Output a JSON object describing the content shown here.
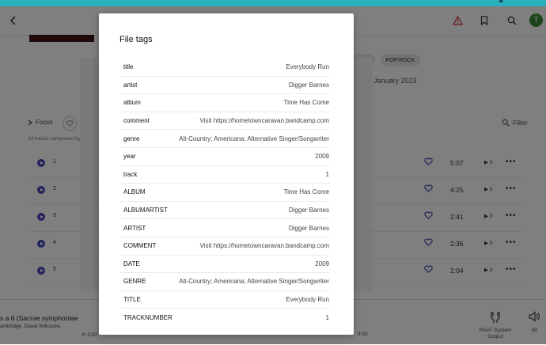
{
  "header": {
    "icons": [
      "chevron-left-icon",
      "warning-icon",
      "bookmark-icon",
      "search-icon"
    ],
    "avatar_letter": "T"
  },
  "album": {
    "genre_chip": "POP/ROCK",
    "date": "January 2023",
    "focus_label": "Focus",
    "composed_note": "All tracks composed by",
    "filter_label": "Filter"
  },
  "tracks": [
    {
      "num": "1",
      "duration": "5:07",
      "plays": "3"
    },
    {
      "num": "2",
      "duration": "4:25",
      "plays": "3"
    },
    {
      "num": "3",
      "duration": "2:41",
      "plays": "3"
    },
    {
      "num": "4",
      "duration": "2:36",
      "plays": "3"
    },
    {
      "num": "5",
      "duration": "2:04",
      "plays": "3"
    }
  ],
  "player": {
    "title": "s a 6 (Sacrae symphoniae",
    "artist": "ambridge, David Willcocks",
    "elapsed": "2:02",
    "total": "3:33",
    "zone_line1": "RAAT System",
    "zone_line2": "Output",
    "volume": "80"
  },
  "modal": {
    "title": "File tags",
    "tags": [
      {
        "key": "title",
        "value": "Everybody Run"
      },
      {
        "key": "artist",
        "value": "Digger Barnes"
      },
      {
        "key": "album",
        "value": "Time Has Come"
      },
      {
        "key": "comment",
        "value": "Visit https://hometowncaravan.bandcamp.com"
      },
      {
        "key": "genre",
        "value": "Alt-Country; Americana; Alternative Singer/Songwriter"
      },
      {
        "key": "year",
        "value": "2009"
      },
      {
        "key": "track",
        "value": "1"
      },
      {
        "key": "ALBUM",
        "value": "Time Has Come"
      },
      {
        "key": "ALBUMARTIST",
        "value": "Digger Barnes"
      },
      {
        "key": "ARTIST",
        "value": "Digger Barnes"
      },
      {
        "key": "COMMENT",
        "value": "Visit https://hometowncaravan.bandcamp.com"
      },
      {
        "key": "DATE",
        "value": "2009"
      },
      {
        "key": "GENRE",
        "value": "Alt-Country; Americana; Alternative Singer/Songwriter"
      },
      {
        "key": "TITLE",
        "value": "Everybody Run"
      },
      {
        "key": "TRACKNUMBER",
        "value": "1"
      }
    ]
  },
  "colors": {
    "accent": "#4848b8",
    "top_strip": "#27b1bd",
    "avatar_bg": "#3e8a35",
    "warning": "#d23a3a"
  }
}
